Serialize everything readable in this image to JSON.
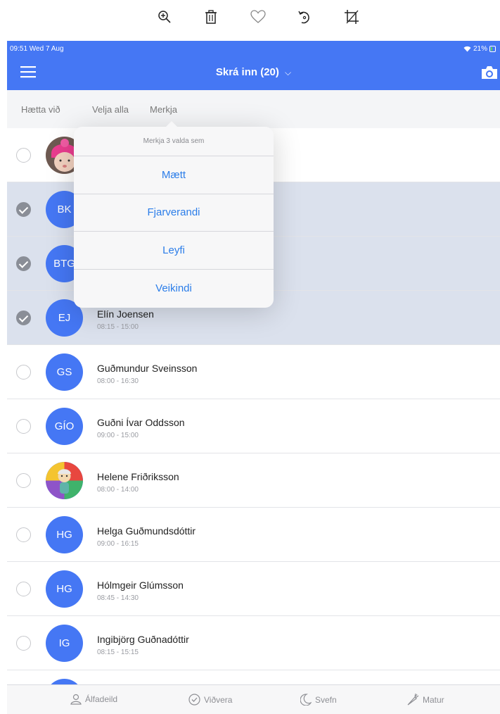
{
  "viewer": {
    "icons": [
      "zoom-in-icon",
      "trash-icon",
      "heart-icon",
      "rotate-icon",
      "crop-icon"
    ]
  },
  "status": {
    "time": "09:51  Wed 7 Aug",
    "battery": "21%"
  },
  "nav": {
    "title": "Skrá inn (20)",
    "title_caret": "⌵"
  },
  "actions": {
    "cancel": "Hætta við",
    "select_all": "Velja alla",
    "mark": "Merkja"
  },
  "popover": {
    "title": "Merkja 3 valda sem",
    "items": [
      "Mætt",
      "Fjarverandi",
      "Leyfi",
      "Veikindi"
    ]
  },
  "rows": [
    {
      "initials": "",
      "name": "",
      "hours": "",
      "selected": false,
      "photo": "baby"
    },
    {
      "initials": "BK",
      "name": "",
      "hours": "",
      "selected": true
    },
    {
      "initials": "BTG",
      "name": "",
      "hours": "",
      "selected": true
    },
    {
      "initials": "EJ",
      "name": "Elín Joensen",
      "hours": "08:15 - 15:00",
      "selected": true
    },
    {
      "initials": "GS",
      "name": "Guðmundur Sveinsson",
      "hours": "08:00 - 16:30",
      "selected": false
    },
    {
      "initials": "GÍO",
      "name": "Guðni Ívar Oddsson",
      "hours": "09:00 - 15:00",
      "selected": false
    },
    {
      "initials": "",
      "name": "Helene Friðriksson",
      "hours": "08:00 - 14:00",
      "selected": false,
      "photo": "cartoon"
    },
    {
      "initials": "HG",
      "name": "Helga Guðmundsdóttir",
      "hours": "09:00 - 16:15",
      "selected": false
    },
    {
      "initials": "HG",
      "name": "Hólmgeir Glúmsson",
      "hours": "08:45 - 14:30",
      "selected": false
    },
    {
      "initials": "IG",
      "name": "Ingibjörg Guðnadóttir",
      "hours": "08:15 - 15:15",
      "selected": false
    }
  ],
  "tabs": [
    {
      "label": "Álfadeild",
      "icon": "person-icon"
    },
    {
      "label": "Viðvera",
      "icon": "check-circle-icon"
    },
    {
      "label": "Svefn",
      "icon": "moon-icon"
    },
    {
      "label": "Matur",
      "icon": "carrot-icon"
    }
  ],
  "colors": {
    "brand": "#4577f4",
    "link": "#2b7de9",
    "selected_row": "#dbe1ed"
  }
}
